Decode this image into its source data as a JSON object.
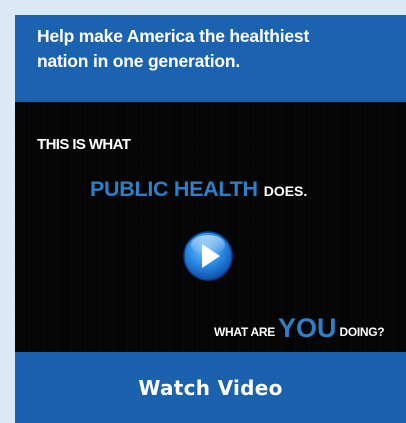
{
  "header": {
    "title": "Help make America the healthiest\nnation in one generation."
  },
  "video": {
    "line1": "THIS IS WHAT",
    "line2_big": "PUBLIC HEALTH",
    "line2_small": "DOES.",
    "line3_small_a": "WHAT ARE",
    "line3_big": "YOU",
    "line3_small_b": "DOING?",
    "play_icon": "play-icon"
  },
  "cta": {
    "label": "Watch Video"
  },
  "colors": {
    "page_bg": "#dbe9f6",
    "brand_blue": "#1b63b0",
    "accent_blue_text": "#2e7ec8",
    "video_bg": "#050505"
  }
}
